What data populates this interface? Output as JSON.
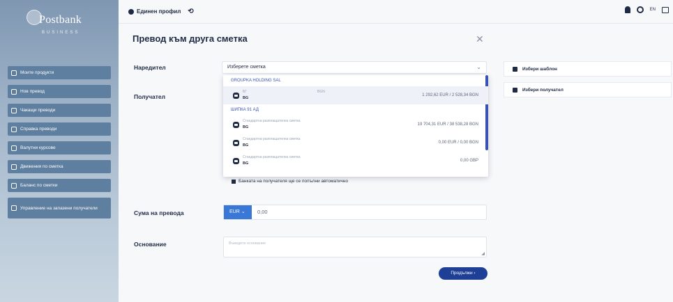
{
  "brand": {
    "name": "Postbank",
    "sub": "BUSINESS"
  },
  "sidebar": {
    "items": [
      {
        "label": "Моите продукти"
      },
      {
        "label": "Нов превод"
      },
      {
        "label": "Чакащи преводи"
      },
      {
        "label": "Справка преводи"
      },
      {
        "label": "Валутни курсове"
      },
      {
        "label": "Движения по сметка"
      },
      {
        "label": "Баланс по сметки"
      },
      {
        "label": "Управление на запазени получатели"
      }
    ]
  },
  "topbar": {
    "profile": "Единен профил",
    "lang": "EN"
  },
  "form": {
    "title": "Превод към друга сметка",
    "sender_label": "Наредител",
    "sender_placeholder": "Изберете сметка",
    "receiver_label": "Получател",
    "amount_label": "Сума на превода",
    "currency": "EUR",
    "amount_value": "0,00",
    "reason_label": "Основание",
    "reason_placeholder": "Въведете основание",
    "checkbox_text": "Банката на получателя ще се попълни автоматично",
    "continue": "Продължи"
  },
  "dropdown": {
    "groups": [
      {
        "name": "GROUPKA HOLDING SAL",
        "items": [
          {
            "name": "БГ",
            "iban": "BG",
            "cur": "BGN",
            "balance": "1 292,62 EUR / 2 528,34 BGN",
            "selected": true
          }
        ]
      },
      {
        "name": "ШИПКА 91 АД",
        "items": [
          {
            "name": "Стандартна разплащателна сметка",
            "iban": "BG",
            "cur": "",
            "balance": "19 704,31 EUR / 38 538,28 BGN"
          },
          {
            "name": "Стандартна разплащателна сметка",
            "iban": "BG",
            "cur": "",
            "balance": "0,00 EUR / 0,00 BGN"
          },
          {
            "name": "Стандартна разплащателна сметка",
            "iban": "BG",
            "cur": "",
            "balance": "0,00 GBP"
          }
        ]
      }
    ]
  },
  "right": {
    "template": "Избери шаблон",
    "receiver": "Избери получател"
  }
}
